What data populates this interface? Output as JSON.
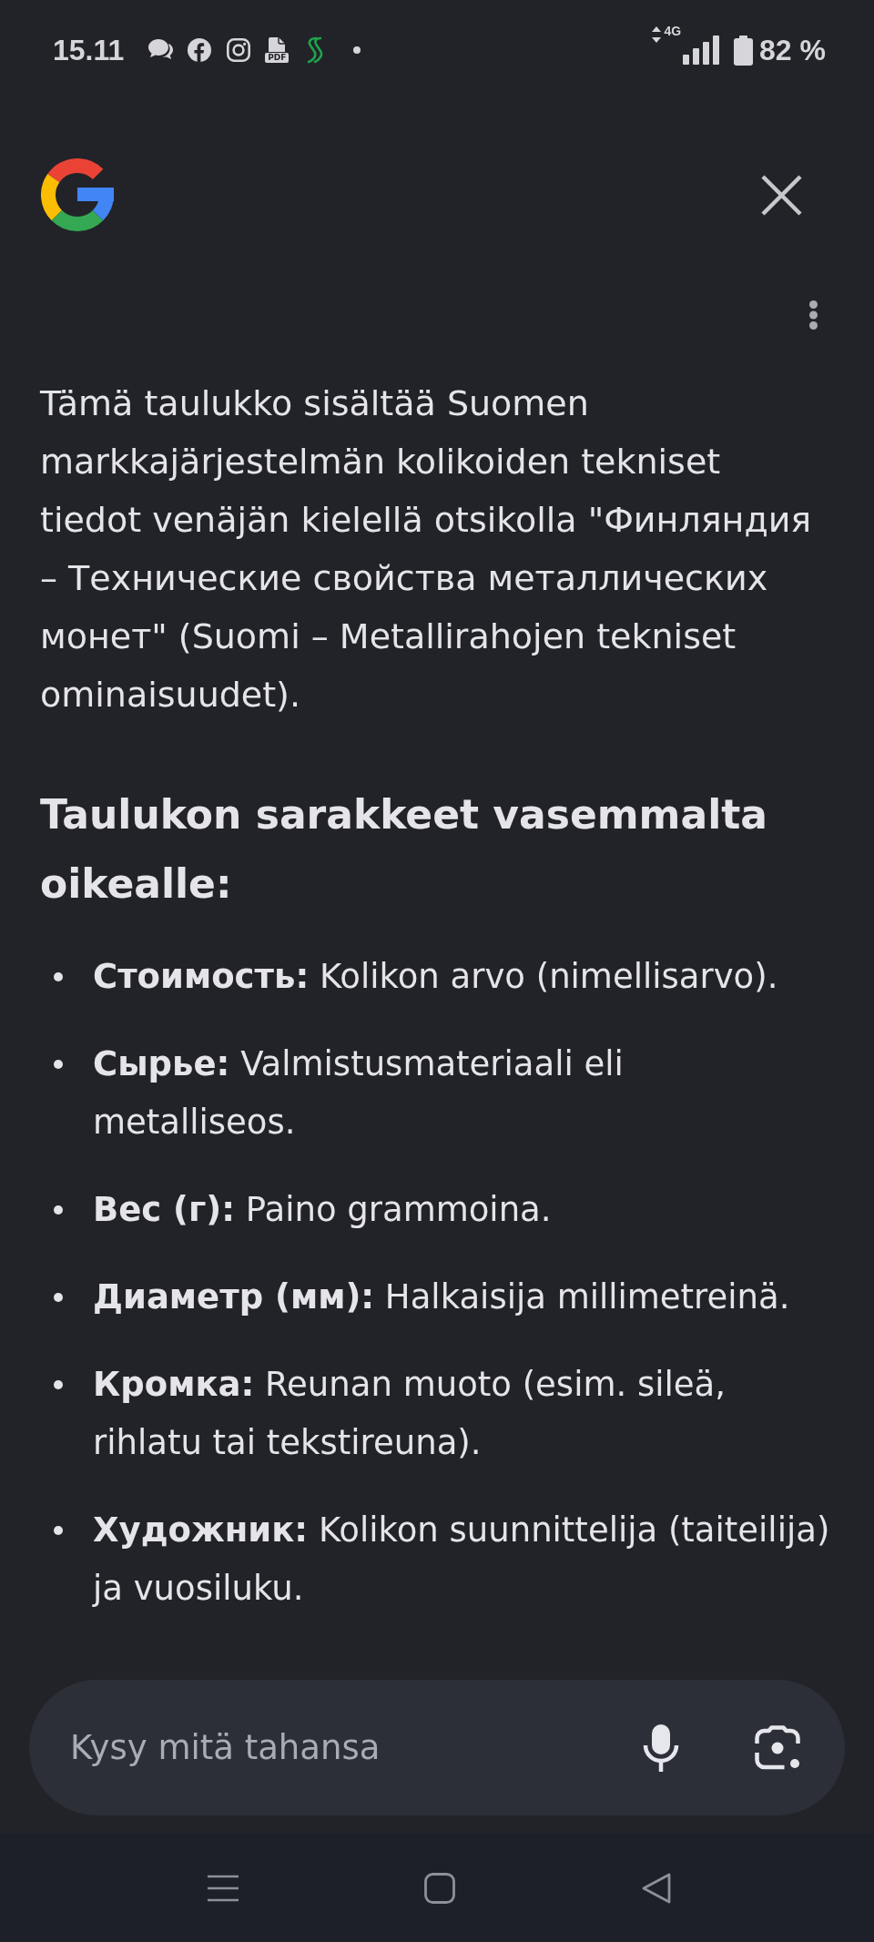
{
  "status_bar": {
    "time": "15.11",
    "pdf_label": "PDF",
    "network": "4G",
    "battery": "82 %"
  },
  "answer": {
    "paragraph": "Tämä taulukko sisältää Suomen markkajärjestelmän kolikoiden tekniset tiedot venäjän kielellä otsikolla \"Финляндия – Технические свойства металлических монет\" (Suomi – Metallirahojen tekniset ominaisuudet).",
    "heading": "Taulukon sarakkeet vasemmalta oikealle:",
    "items": [
      "**Стоимость:** Kolikon arvo (nimellisarvo).",
      "**Сырье:** Valmistusmateriaali eli metalliseos.",
      "**Вес (г):** Paino grammoina.",
      "**Диаметр (мм):** Halkaisija millimetreinä.",
      "**Кромка:** Reunan muoto (esim. sileä, rihlatu tai tekstireuna).",
      "**Художник:** Kolikon suunnittelija (taiteilija) ja vuosiluku."
    ]
  },
  "search": {
    "placeholder": "Kysy mitä tahansa"
  }
}
